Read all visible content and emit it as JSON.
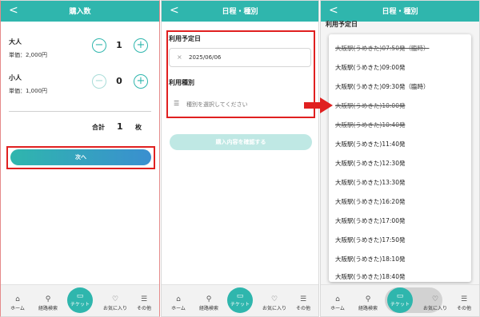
{
  "panel1": {
    "title": "購入数",
    "back": "<",
    "adult": {
      "label": "大人",
      "price": "単価：2,000円",
      "qty": "1"
    },
    "child": {
      "label": "小人",
      "price": "単価：1,000円",
      "qty": "0"
    },
    "total_label": "合計",
    "total_qty": "1",
    "total_unit": "枚",
    "next_button": "次へ"
  },
  "panel2": {
    "title": "日程・種別",
    "back": "<",
    "date_label": "利用予定日",
    "date_value": "2025/06/06",
    "clear": "×",
    "type_label": "利用種別",
    "type_placeholder": "種別を選択してください",
    "confirm_button": "購入内容を確認する"
  },
  "panel3": {
    "title": "日程・種別",
    "back": "<",
    "date_label": "利用予定日",
    "options": [
      {
        "label": "大阪駅(うめきた)07:50発（臨時）",
        "struck": true
      },
      {
        "label": "大阪駅(うめきた)09:00発",
        "struck": false
      },
      {
        "label": "大阪駅(うめきた)09:30発（臨時）",
        "struck": false
      },
      {
        "label": "大阪駅(うめきた)10:00発",
        "struck": true
      },
      {
        "label": "大阪駅(うめきた)10:40発",
        "struck": true
      },
      {
        "label": "大阪駅(うめきた)11:40発",
        "struck": false
      },
      {
        "label": "大阪駅(うめきた)12:30発",
        "struck": false
      },
      {
        "label": "大阪駅(うめきた)13:30発",
        "struck": false
      },
      {
        "label": "大阪駅(うめきた)16:20発",
        "struck": false
      },
      {
        "label": "大阪駅(うめきた)17:00発",
        "struck": false
      },
      {
        "label": "大阪駅(うめきた)17:50発",
        "struck": false
      },
      {
        "label": "大阪駅(うめきた)18:10発",
        "struck": false
      },
      {
        "label": "大阪駅(うめきた)18:40発",
        "struck": false
      }
    ]
  },
  "tabbar": {
    "home": "ホーム",
    "route": "経路検索",
    "ticket": "チケット",
    "favorites": "お気に入り",
    "other": "その他"
  },
  "icons": {
    "home": "home-icon",
    "route": "route-icon",
    "ticket": "ticket-icon",
    "favorites": "heart-icon",
    "other": "menu-icon"
  },
  "colors": {
    "accent": "#2fb6ad",
    "highlight": "#e02020",
    "arrow": "#e02020"
  }
}
